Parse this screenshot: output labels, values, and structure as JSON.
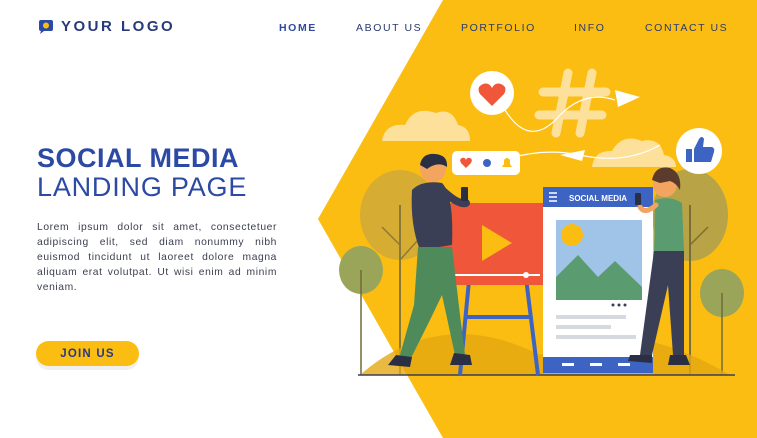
{
  "brand": {
    "logo_text": "YOUR LOGO"
  },
  "nav": {
    "items": [
      {
        "id": "home",
        "label": "HOME"
      },
      {
        "id": "about",
        "label": "ABOUT US"
      },
      {
        "id": "portfolio",
        "label": "PORTFOLIO"
      },
      {
        "id": "info",
        "label": "INFO"
      },
      {
        "id": "contact",
        "label": "CONTACT US"
      }
    ]
  },
  "hero": {
    "headline_line1": "SOCIAL MEDIA",
    "headline_line2": "LANDING PAGE",
    "body": "Lorem ipsum dolor sit amet, consectetuer adipiscing elit, sed diam nonummy nibh euismod tincidunt ut laoreet dolore magna aliquam erat volutpat. Ut wisi enim ad minim veniam.",
    "cta_label": "JOIN US"
  },
  "illustration": {
    "phone_header_label": "SOCIAL MEDIA"
  },
  "colors": {
    "accent_yellow": "#fbbd11",
    "brand_blue": "#2c4aa3",
    "video_red": "#f0573a"
  },
  "icons": [
    "logo-icon",
    "heart-icon",
    "hashtag-icon",
    "thumbs-up-icon",
    "play-icon",
    "menu-icon"
  ]
}
